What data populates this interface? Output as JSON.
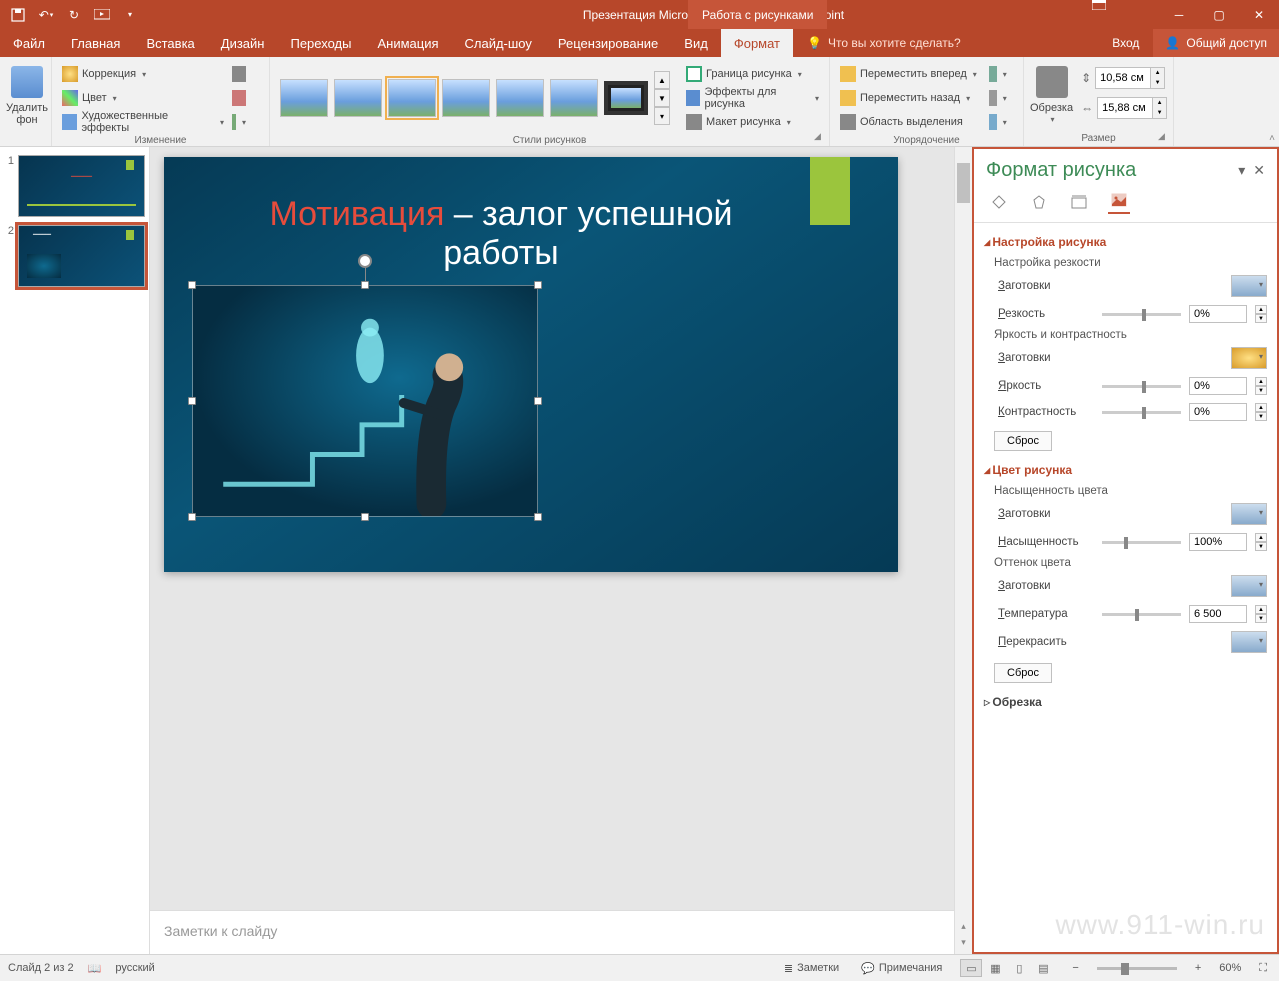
{
  "titlebar": {
    "doc_title": "Презентация Microsoft PowerPoint - PowerPoint",
    "context_tab": "Работа с рисунками"
  },
  "tabs": {
    "file": "Файл",
    "home": "Главная",
    "insert": "Вставка",
    "design": "Дизайн",
    "transitions": "Переходы",
    "animations": "Анимация",
    "slideshow": "Слайд-шоу",
    "review": "Рецензирование",
    "view": "Вид",
    "format": "Формат",
    "tellme": "Что вы хотите сделать?",
    "login": "Вход",
    "share": "Общий доступ"
  },
  "ribbon": {
    "remove_bg": "Удалить\nфон",
    "corrections": "Коррекция",
    "color": "Цвет",
    "artistic": "Художественные эффекты",
    "group_change": "Изменение",
    "group_styles": "Стили рисунков",
    "border": "Граница рисунка",
    "effects": "Эффекты для рисунка",
    "layout": "Макет рисунка",
    "bring_fwd": "Переместить вперед",
    "send_back": "Переместить назад",
    "selection": "Область выделения",
    "group_arrange": "Упорядочение",
    "crop": "Обрезка",
    "height": "10,58 см",
    "width": "15,88 см",
    "group_size": "Размер"
  },
  "thumbs": {
    "n1": "1",
    "n2": "2"
  },
  "slide": {
    "title_red": "Мотивация",
    "title_rest": " – залог успешной работы"
  },
  "notes": {
    "placeholder": "Заметки к слайду"
  },
  "pane": {
    "title": "Формат рисунка",
    "section_pic": "Настройка рисунка",
    "sharp_sub": "Настройка резкости",
    "presets": "Заготовки",
    "sharpness": "Резкость",
    "sharpness_v": "0%",
    "bc_sub": "Яркость и контрастность",
    "brightness": "Яркость",
    "brightness_v": "0%",
    "contrast": "Контрастность",
    "contrast_v": "0%",
    "reset": "Сброс",
    "section_color": "Цвет рисунка",
    "sat_sub": "Насыщенность цвета",
    "saturation": "Насыщенность",
    "saturation_v": "100%",
    "tone_sub": "Оттенок цвета",
    "temperature": "Температура",
    "temperature_v": "6 500",
    "recolor": "Перекрасить",
    "section_crop": "Обрезка"
  },
  "status": {
    "slide": "Слайд 2 из 2",
    "lang": "русский",
    "notes": "Заметки",
    "comments": "Примечания",
    "zoom": "60%"
  },
  "watermark": "www.911-win.ru"
}
